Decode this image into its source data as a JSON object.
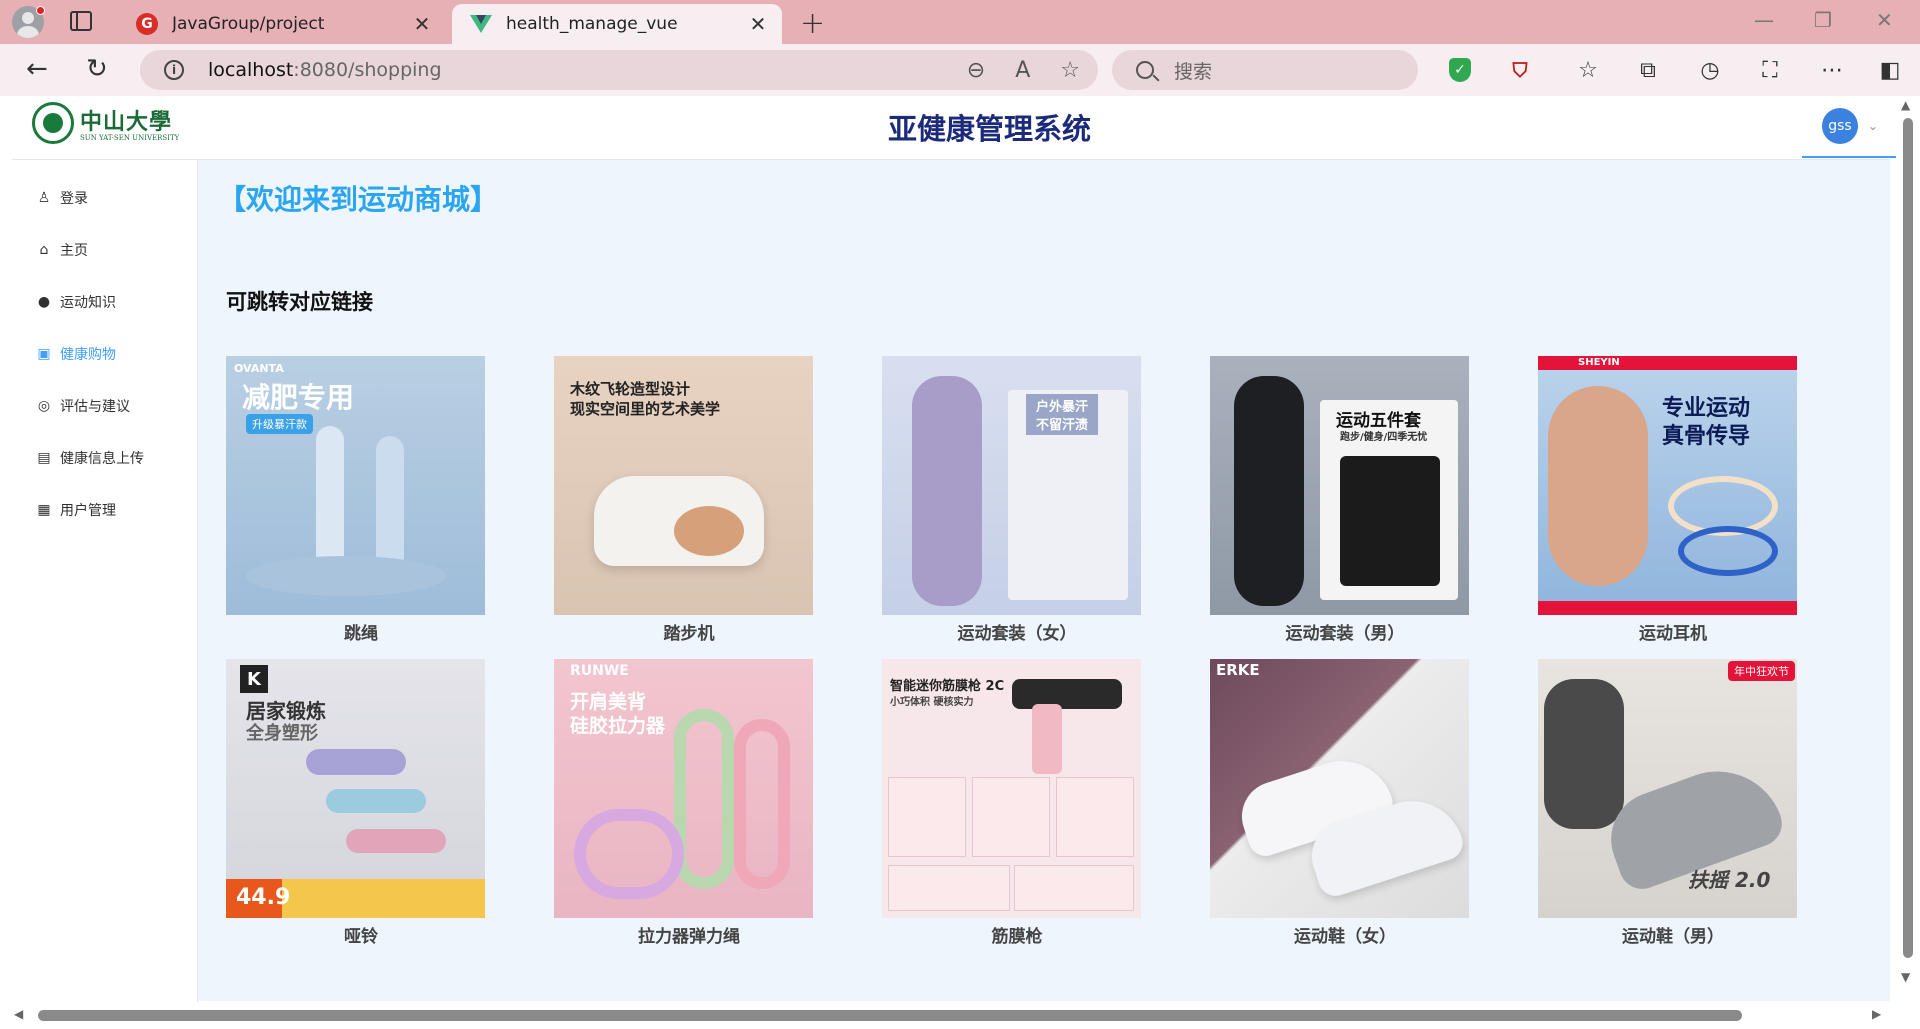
{
  "browser": {
    "tabs": [
      {
        "title": "JavaGroup/project",
        "favicon": "gitee-icon",
        "active": false
      },
      {
        "title": "health_manage_vue",
        "favicon": "vue-icon",
        "active": true
      }
    ],
    "url_host": "localhost",
    "url_path": ":8080/shopping",
    "search_placeholder": "搜索",
    "shield_label": "✓",
    "mcafee_label": "⛉"
  },
  "header": {
    "logo_cn": "中山大學",
    "logo_en": "SUN YAT-SEN UNIVERSITY",
    "title": "亚健康管理系统",
    "user_avatar": "gss"
  },
  "sidebar": {
    "items": [
      {
        "label": "登录",
        "icon": "user-icon",
        "glyph": "♙",
        "active": false
      },
      {
        "label": "主页",
        "icon": "home-icon",
        "glyph": "⌂",
        "active": false
      },
      {
        "label": "运动知识",
        "icon": "location-icon",
        "glyph": "●",
        "active": false
      },
      {
        "label": "健康购物",
        "icon": "shopping-bag-icon",
        "glyph": "▣",
        "active": true
      },
      {
        "label": "评估与建议",
        "icon": "chat-icon",
        "glyph": "◎",
        "active": false
      },
      {
        "label": "健康信息上传",
        "icon": "document-icon",
        "glyph": "▤",
        "active": false
      },
      {
        "label": "用户管理",
        "icon": "notebook-icon",
        "glyph": "▦",
        "active": false
      }
    ]
  },
  "main": {
    "welcome": "【欢迎来到运动商城】",
    "subtitle": "可跳转对应链接",
    "products": [
      {
        "name": "跳绳",
        "img_text": "减肥专用",
        "img_tag": "升级暴汗款",
        "brand": "OVANTA"
      },
      {
        "name": "踏步机",
        "img_text": "木纹飞轮造型设计",
        "img_text2": "现实空间里的艺术美学"
      },
      {
        "name": "运动套装（女）",
        "img_text": "户外暴汗",
        "img_text2": "不留汗渍"
      },
      {
        "name": "运动套装（男）",
        "img_text": "运动五件套",
        "img_text2": "跑步/健身/四季无忧"
      },
      {
        "name": "运动耳机",
        "img_text": "专业运动",
        "img_text2": "真骨传导",
        "brand": "SHEYIN"
      },
      {
        "name": "哑铃",
        "img_text": "居家锻炼",
        "img_text2": "全身塑形",
        "price": "44.9"
      },
      {
        "name": "拉力器弹力绳",
        "img_text": "开肩美背",
        "img_text2": "硅胶拉力器",
        "brand": "RUNWE"
      },
      {
        "name": "筋膜枪",
        "img_text": "智能迷你筋膜枪 2C",
        "img_text2": "小巧体积 硬核实力"
      },
      {
        "name": "运动鞋（女）",
        "brand": "ERKE"
      },
      {
        "name": "运动鞋（男）",
        "img_text": "扶摇 2.0",
        "img_tag": "年中狂欢节"
      }
    ]
  }
}
